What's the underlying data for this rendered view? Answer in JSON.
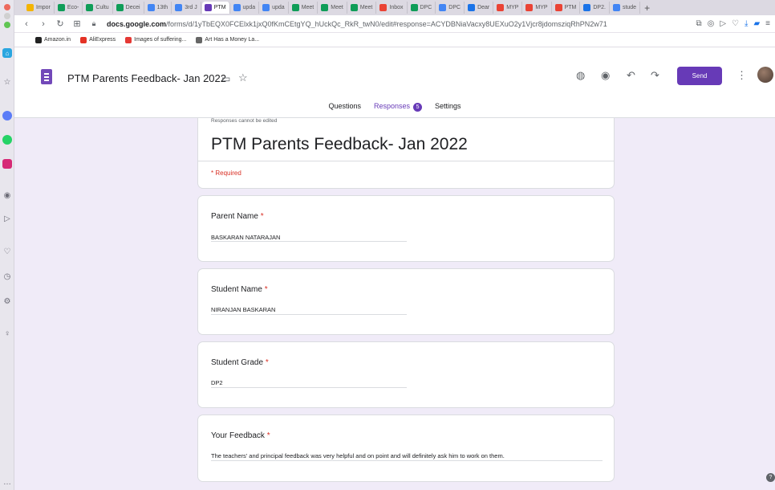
{
  "browser": {
    "tabs": [
      "Impor",
      "Eco-",
      "Cultu",
      "Decei",
      "13th",
      "3rd J",
      "PTM",
      "upda",
      "upda",
      "Meet",
      "Meet",
      "Meet",
      "Inbox",
      "DPC",
      "DPC",
      "Dear",
      "MYP",
      "MYP",
      "PTM",
      "DP2.",
      "stude"
    ],
    "tab_colors": [
      "#f4b400",
      "#0f9d58",
      "#0f9d58",
      "#0f9d58",
      "#4285f4",
      "#4285f4",
      "#673ab7",
      "#4285f4",
      "#4285f4",
      "#0f9d58",
      "#0f9d58",
      "#0f9d58",
      "#ea4335",
      "#0f9d58",
      "#4285f4",
      "#1a73e8",
      "#ea4335",
      "#ea4335",
      "#ea4335",
      "#1a73e8",
      "#4285f4"
    ],
    "active_tab_index": 6,
    "url_host": "docs.google.com",
    "url_path": "/forms/d/1yTbEQX0FCElxk1jxQ0fKmCEtgYQ_hUckQc_RkR_twN0/edit#response=ACYDBNiaVacxy8UEXuO2y1Vjcr8jdomsziqRhPN2w71",
    "bookmarks": [
      {
        "label": "Amazon.in",
        "color": "#222"
      },
      {
        "label": "AliExpress",
        "color": "#e43225"
      },
      {
        "label": "Images of suffering...",
        "color": "#e53935"
      },
      {
        "label": "Art Has a Money La...",
        "color": "#666"
      }
    ]
  },
  "form": {
    "title": "PTM Parents Feedback- Jan 2022",
    "send_label": "Send",
    "tabs": {
      "questions": "Questions",
      "responses": "Responses",
      "responses_count": "5",
      "settings": "Settings"
    },
    "header_card": {
      "note": "Responses cannot be edited",
      "title": "PTM Parents Feedback- Jan 2022",
      "required_note": "* Required"
    },
    "questions": [
      {
        "label": "Parent Name",
        "required_mark": "*",
        "answer": "BASKARAN NATARAJAN"
      },
      {
        "label": "Student Name",
        "required_mark": "*",
        "answer": "NIRANJAN BASKARAN"
      },
      {
        "label": "Student Grade",
        "required_mark": "*",
        "answer": "DP2"
      },
      {
        "label": "Your Feedback",
        "required_mark": "*",
        "answer": "The teachers' and principal feedback was very helpful and on point and will definitely ask him to work on them."
      }
    ]
  },
  "colors": {
    "accent": "#673ab7",
    "background": "#f0ebf8",
    "required": "#d93025"
  }
}
